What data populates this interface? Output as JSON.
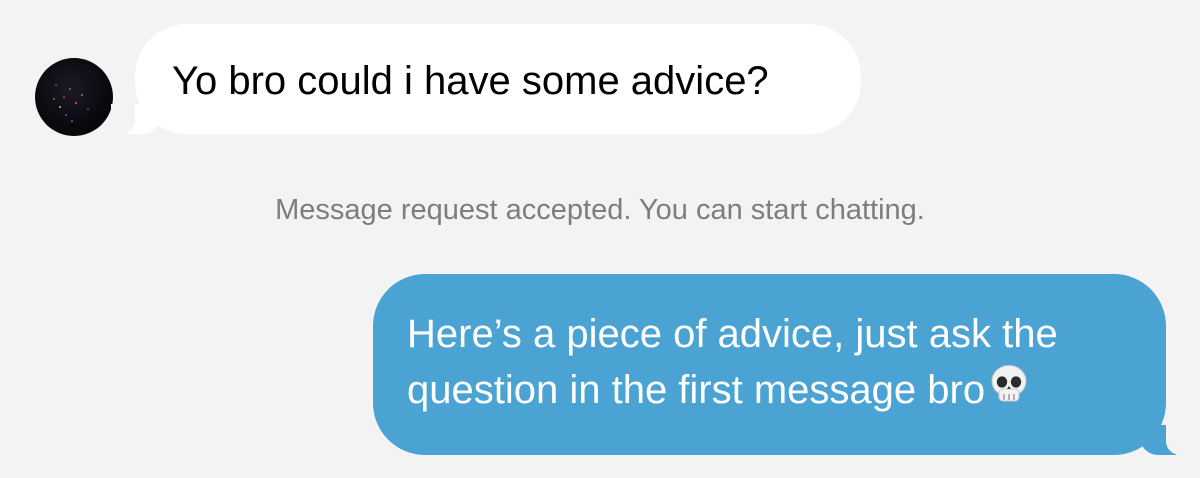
{
  "conversation": {
    "incoming": {
      "avatar_icon": "profile-avatar",
      "text": "Yo bro could i have some advice?"
    },
    "system_notice": "Message request accepted. You can start chatting.",
    "outgoing": {
      "line1": "Here’s a piece of advice, just ask the",
      "line2": "question in the first message bro",
      "emoji": "skull-emoji"
    }
  },
  "colors": {
    "background": "#f3f3f3",
    "incoming_bubble": "#ffffff",
    "outgoing_bubble": "#4aa3d2",
    "system_text": "#7d7d7d"
  }
}
